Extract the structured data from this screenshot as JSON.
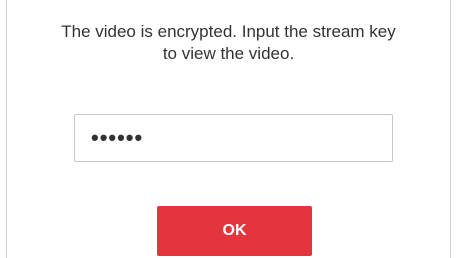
{
  "dialog": {
    "message_line1": "The video is encrypted. Input the stream key",
    "message_line2": "to view the video.",
    "stream_key_value": "123456",
    "ok_label": "OK",
    "colors": {
      "ok_button_bg": "#e5353c",
      "border": "#c8c8c8",
      "text": "#333333"
    }
  }
}
